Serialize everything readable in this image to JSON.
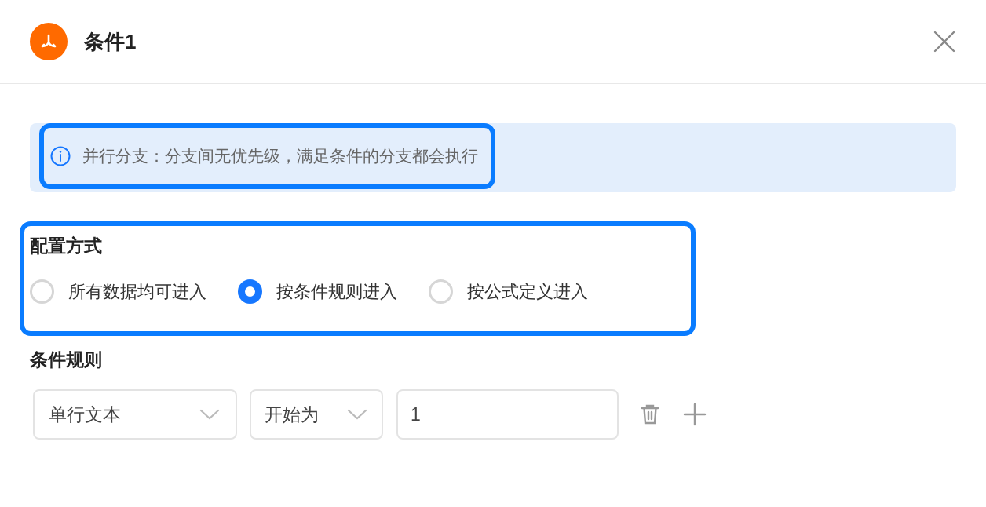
{
  "header": {
    "title": "条件1"
  },
  "info_banner": {
    "text": "并行分支：分支间无优先级，满足条件的分支都会执行",
    "highlighted": true
  },
  "config_mode": {
    "label": "配置方式",
    "highlighted": true,
    "options": [
      {
        "label": "所有数据均可进入",
        "selected": false
      },
      {
        "label": "按条件规则进入",
        "selected": true
      },
      {
        "label": "按公式定义进入",
        "selected": false
      }
    ]
  },
  "condition_rules": {
    "label": "条件规则",
    "rules": [
      {
        "field": "单行文本",
        "operator": "开始为",
        "value": "1"
      }
    ]
  }
}
